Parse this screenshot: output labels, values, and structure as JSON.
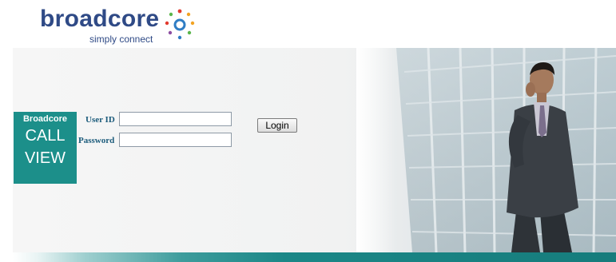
{
  "logo": {
    "wordmark": "broadcore",
    "tagline": "simply connect",
    "colors": {
      "wordmark": "#2f4a86",
      "dots": [
        "#e23a2e",
        "#f2a323",
        "#5ab54b",
        "#2f7dc4",
        "#8d4fa2"
      ]
    }
  },
  "badge": {
    "brand": "Broadcore",
    "line1": "CALL",
    "line2": "VIEW",
    "color": "#1c8f8a"
  },
  "form": {
    "userid_label": "User ID",
    "userid_value": "",
    "password_label": "Password",
    "password_value": "",
    "login_label": "Login"
  },
  "accent_color": "#167c7c"
}
